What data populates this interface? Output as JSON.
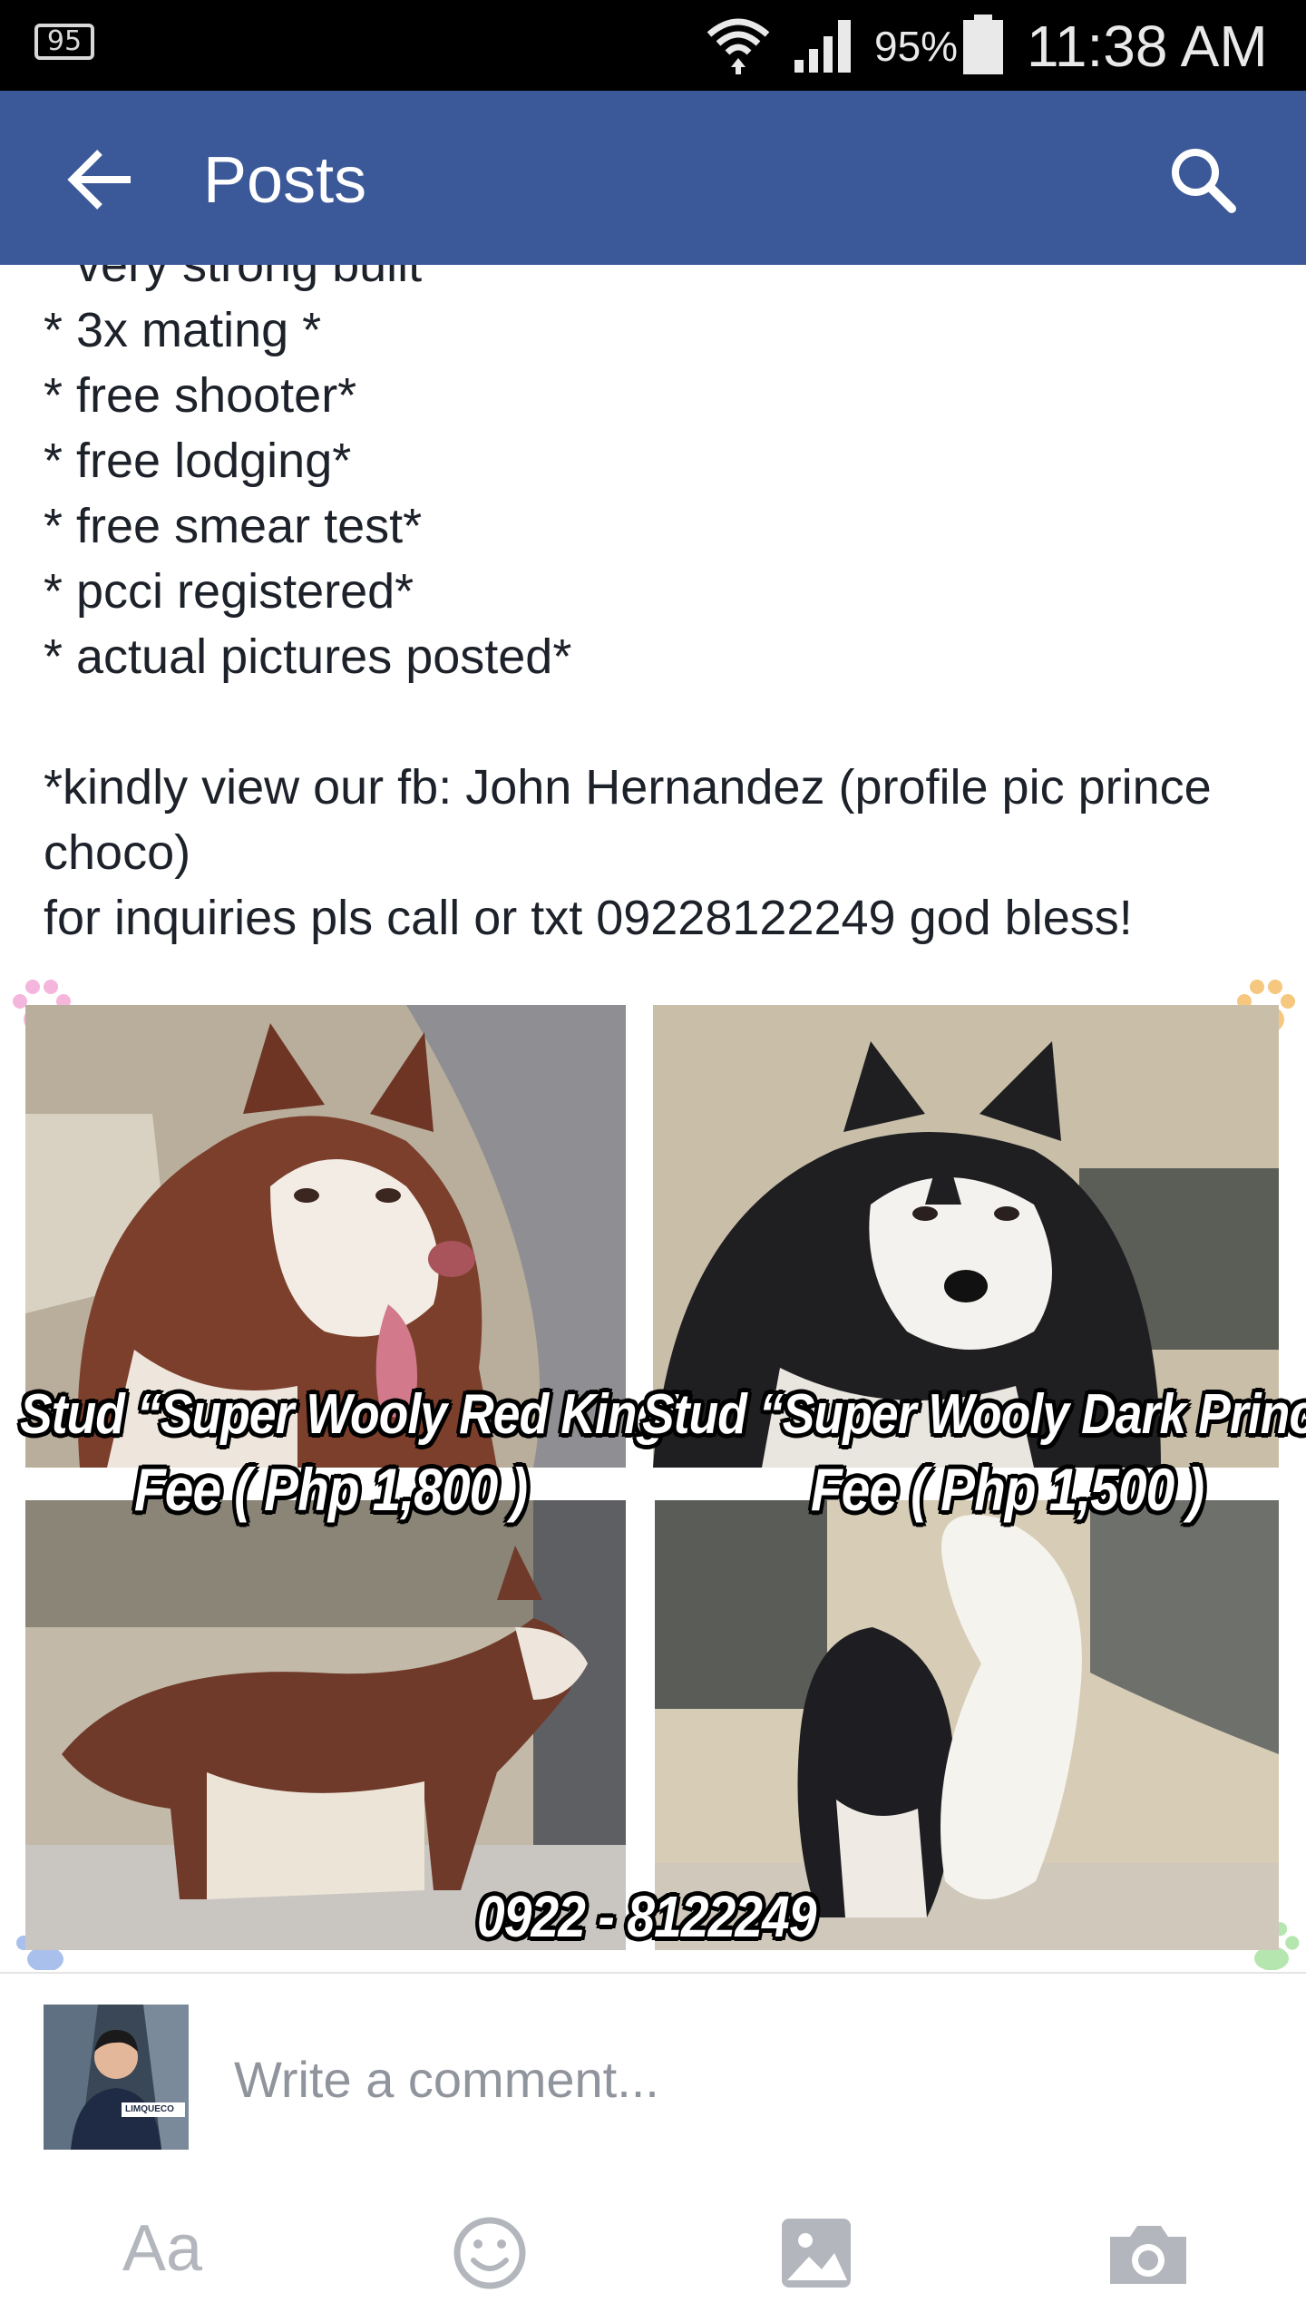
{
  "status_bar": {
    "notification_count": "95",
    "battery_percent": "95%",
    "time": "11:38 AM",
    "icons": [
      "wifi-icon",
      "signal-icon",
      "battery-icon"
    ]
  },
  "app_bar": {
    "title": "Posts",
    "back_icon": "arrow-left-icon",
    "search_icon": "search-icon",
    "color": "#3b5998"
  },
  "post": {
    "lines": [
      "* very strong built",
      "* 3x mating *",
      "* free shooter*",
      "* free lodging*",
      "* free smear test*",
      "* pcci registered*",
      "* actual pictures posted*",
      "",
      "*kindly view our fb: John Hernandez (profile pic prince",
      "choco)",
      "for inquiries pls call or txt 09228122249 god bless!"
    ]
  },
  "collage": {
    "stud_1_name": "Stud “Super Wooly Red King”",
    "stud_1_fee": "Fee ( Php 1,800 )",
    "stud_2_name": "Stud “Super Wooly Dark Prince”",
    "stud_2_fee": "Fee  ( Php 1,500 )",
    "phone": "0922 - 8122249"
  },
  "composer": {
    "placeholder": "Write a comment...",
    "avatar_caption": "LIMQUECO",
    "text_tool_label": "Aa",
    "tools": [
      "emoji-icon",
      "photo-icon",
      "camera-icon"
    ]
  }
}
